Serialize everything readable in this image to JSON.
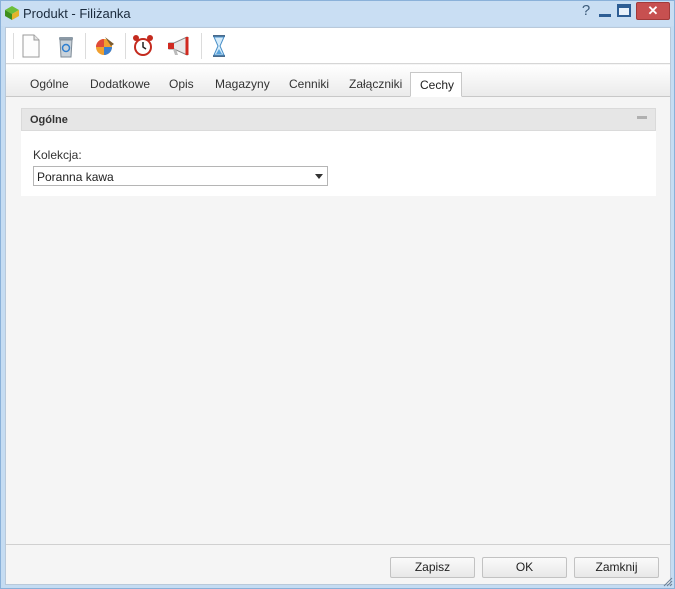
{
  "window": {
    "title": "Produkt - Filiżanka",
    "help_glyph": "?",
    "close_glyph": "✕"
  },
  "toolbar": {
    "buttons": [
      {
        "icon": "new-document-icon"
      },
      {
        "icon": "recycle-bin-icon"
      },
      {
        "icon": "paint-icon"
      },
      {
        "icon": "alarm-clock-icon"
      },
      {
        "icon": "megaphone-icon"
      },
      {
        "icon": "hourglass-icon"
      }
    ]
  },
  "tabs": [
    {
      "label": "Ogólne"
    },
    {
      "label": "Dodatkowe"
    },
    {
      "label": "Opis"
    },
    {
      "label": "Magazyny"
    },
    {
      "label": "Cenniki"
    },
    {
      "label": "Załączniki"
    },
    {
      "label": "Cechy",
      "active": true
    }
  ],
  "panel": {
    "title": "Ogólne",
    "field_label": "Kolekcja:",
    "select_value": "Poranna kawa"
  },
  "footer": {
    "save_label": "Zapisz",
    "ok_label": "OK",
    "close_label": "Zamknij"
  },
  "colors": {
    "close_button": "#c75050",
    "frame": "#c5dcf2"
  }
}
